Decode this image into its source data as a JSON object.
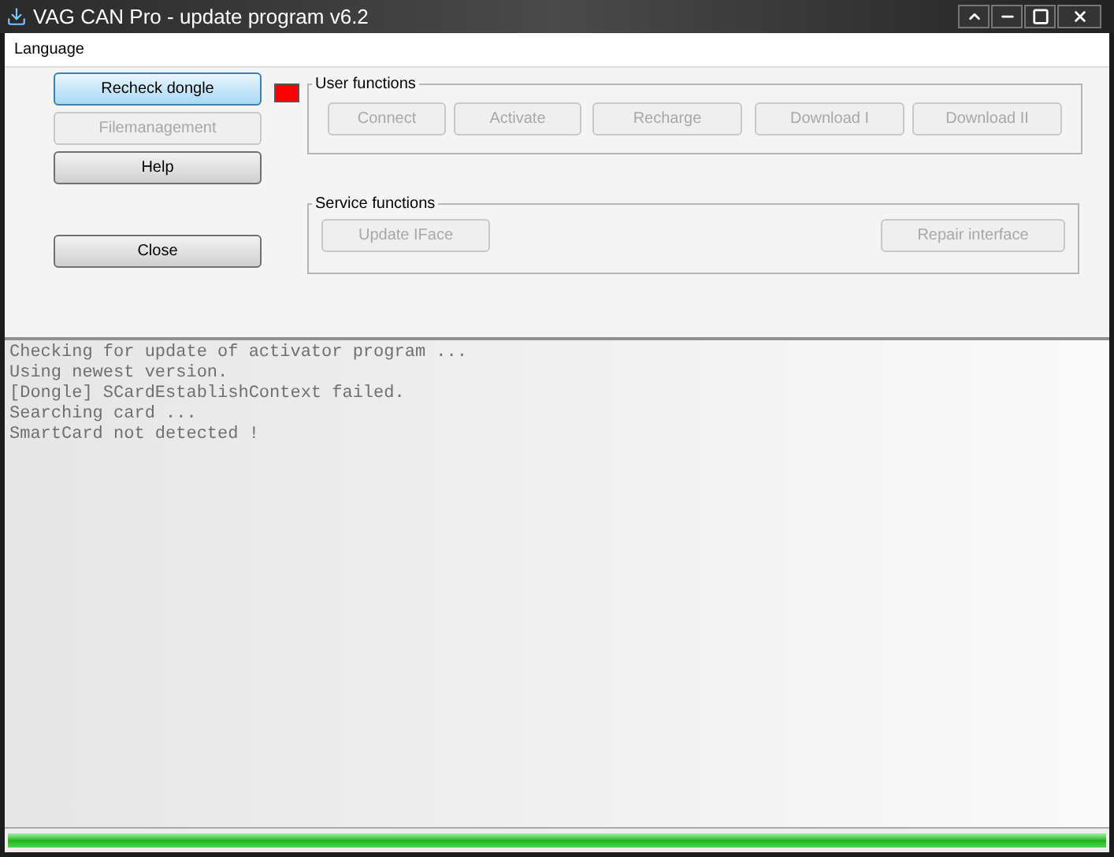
{
  "window": {
    "title": "VAG CAN Pro - update program v6.2"
  },
  "menu": [
    "Language"
  ],
  "left_buttons": [
    {
      "label": "Recheck dongle",
      "disabled": false,
      "focused": true
    },
    {
      "label": "Filemanagement",
      "disabled": true,
      "focused": false
    },
    {
      "label": "Help",
      "disabled": false,
      "focused": false
    },
    {
      "label": "Close",
      "disabled": false,
      "focused": false
    }
  ],
  "status_indicator": {
    "color": "#ff0000"
  },
  "groups": [
    {
      "title": "User functions",
      "buttons": [
        {
          "label": "Connect",
          "disabled": true
        },
        {
          "label": "Activate",
          "disabled": true
        },
        {
          "label": "Recharge",
          "disabled": true
        },
        {
          "label": "Download I",
          "disabled": true
        },
        {
          "label": "Download II",
          "disabled": true
        }
      ]
    },
    {
      "title": "Service functions",
      "buttons": [
        {
          "label": "Update IFace",
          "disabled": true
        },
        {
          "label": "Repair interface",
          "disabled": true
        }
      ]
    }
  ],
  "log": [
    "Checking for update of activator program ...",
    "Using newest version.",
    "[Dongle] SCardEstablishContext failed.",
    "Searching card ...",
    "SmartCard not detected !"
  ],
  "progress": {
    "level": 1
  }
}
